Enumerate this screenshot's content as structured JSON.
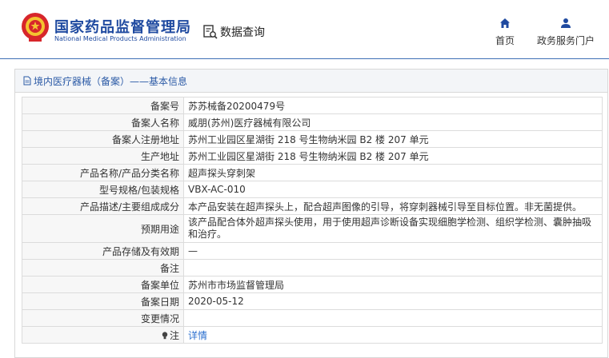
{
  "header": {
    "site_title": "国家药品监督管理局",
    "site_subtitle": "National Medical Products Administration",
    "query_label": "数据查询",
    "nav": [
      {
        "label": "首页",
        "icon": "home-icon"
      },
      {
        "label": "政务服务门户",
        "icon": "user-icon"
      }
    ]
  },
  "breadcrumb": "境内医疗器械（备案）——基本信息",
  "colors": {
    "brand": "#1f4aa0",
    "accent": "#d7262b",
    "link": "#2b6fcf"
  },
  "rows": [
    {
      "key": "备案号",
      "value": "苏苏械备20200479号"
    },
    {
      "key": "备案人名称",
      "value": "威朋(苏州)医疗器械有限公司"
    },
    {
      "key": "备案人注册地址",
      "value": "苏州工业园区星湖街 218 号生物纳米园 B2 楼 207 单元"
    },
    {
      "key": "生产地址",
      "value": "苏州工业园区星湖街 218 号生物纳米园 B2 楼 207 单元"
    },
    {
      "key": "产品名称/产品分类名称",
      "value": "超声探头穿刺架"
    },
    {
      "key": "型号规格/包装规格",
      "value": "VBX-AC-010"
    },
    {
      "key": "产品描述/主要组成成分",
      "value": "本产品安装在超声探头上，配合超声图像的引导，将穿刺器械引导至目标位置。非无菌提供。"
    },
    {
      "key": "预期用途",
      "value": "该产品配合体外超声探头使用，用于使用超声诊断设备实现细胞学检测、组织学检测、囊肿抽吸和治疗。"
    },
    {
      "key": "产品存储及有效期",
      "value": "—"
    },
    {
      "key": "备注",
      "value": ""
    },
    {
      "key": "备案单位",
      "value": "苏州市市场监督管理局"
    },
    {
      "key": "备案日期",
      "value": "2020-05-12"
    },
    {
      "key": "变更情况",
      "value": ""
    },
    {
      "key": "注",
      "value": "详情"
    }
  ]
}
